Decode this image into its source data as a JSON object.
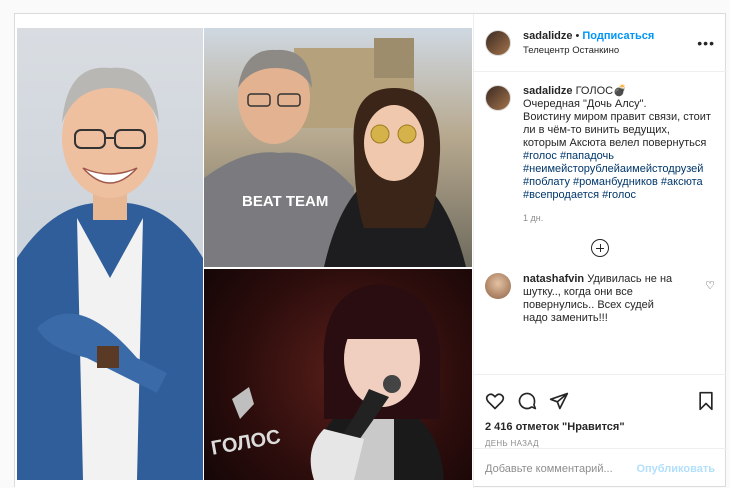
{
  "post": {
    "username": "sadalidze",
    "follow_label": "Подписаться",
    "location": "Телецентр Останкино",
    "caption_title": "ГОЛОС💣",
    "caption_lines": "Очередная \"Дочь Алсу\".\nВоистину миром правит связи, стоит ли в чём-то винить ведущих, которым Аксюта велел повернуться",
    "hashtags": "#голос #пападочь #неимейсторублейаимейстодрузей #поблату #романбудников #аксюта #всепродается #голос",
    "caption_age": "1 дн.",
    "comment": {
      "username": "natashafvin",
      "text": "Удивилась не на шутку.., когда они все повернулись.. Всех судей надо заменить!!!"
    },
    "likes": "2 416 отметок \"Нравится\"",
    "posted_when": "ДЕНЬ НАЗАД",
    "add_comment_placeholder": "Добавьте комментарий...",
    "publish_label": "Опубликовать"
  },
  "icons": [
    "more-options-icon",
    "load-more-icon",
    "like-icon",
    "comment-icon",
    "share-icon",
    "bookmark-icon",
    "comment-like-icon"
  ],
  "photos": {
    "logo_text": "ГОЛОС",
    "tshirt_text": "BEAT TEAM"
  }
}
